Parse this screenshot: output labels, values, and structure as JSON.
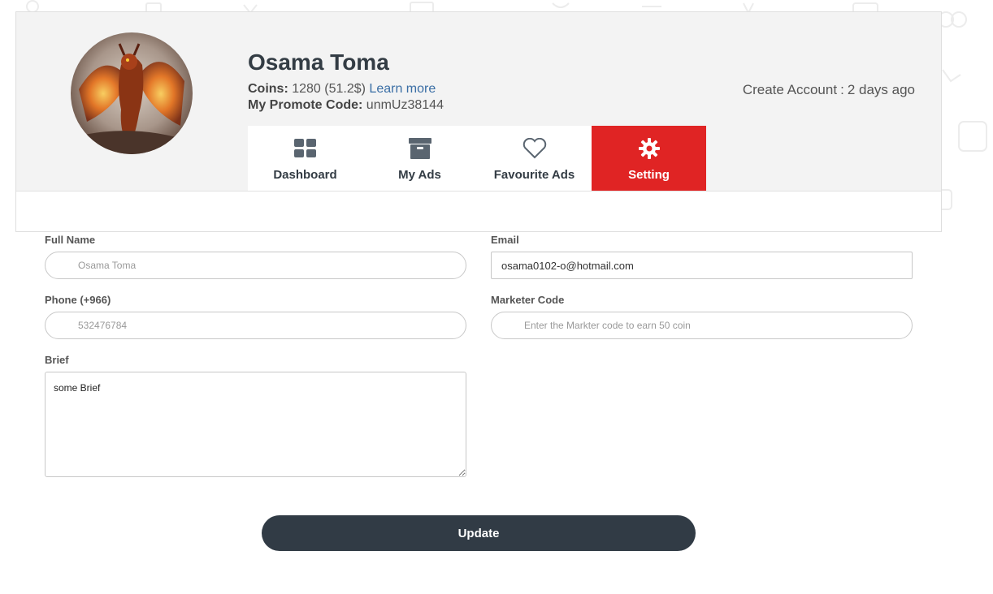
{
  "profile": {
    "name": "Osama Toma",
    "coins_label": "Coins:",
    "coins_value": "1280 (51.2$)",
    "learn_more": "Learn more",
    "promo_label": "My Promote Code:",
    "promo_value": "unmUz38144",
    "created_label": "Create Account",
    "created_sep": ":",
    "created_value": "2 days ago"
  },
  "tabs": [
    {
      "label": "Dashboard",
      "icon": "dashboard-grid-icon",
      "active": false
    },
    {
      "label": "My Ads",
      "icon": "archive-box-icon",
      "active": false
    },
    {
      "label": "Favourite Ads",
      "icon": "heart-icon",
      "active": false
    },
    {
      "label": "Setting",
      "icon": "gear-icon",
      "active": true
    }
  ],
  "form": {
    "full_name": {
      "label": "Full Name",
      "value": "",
      "placeholder": "Osama Toma"
    },
    "email": {
      "label": "Email",
      "value": "osama0102-o@hotmail.com"
    },
    "phone": {
      "label": "Phone (+966)",
      "value": "",
      "placeholder": "532476784"
    },
    "marketer_code": {
      "label": "Marketer Code",
      "value": "",
      "placeholder": "Enter the Markter code to earn 50 coin"
    },
    "brief": {
      "label": "Brief",
      "value": "some Brief"
    },
    "update_label": "Update"
  },
  "colors": {
    "accent_active_tab": "#e02424",
    "button_dark": "#313b45",
    "link": "#3a6ea5",
    "card_bg": "#f3f3f3"
  }
}
